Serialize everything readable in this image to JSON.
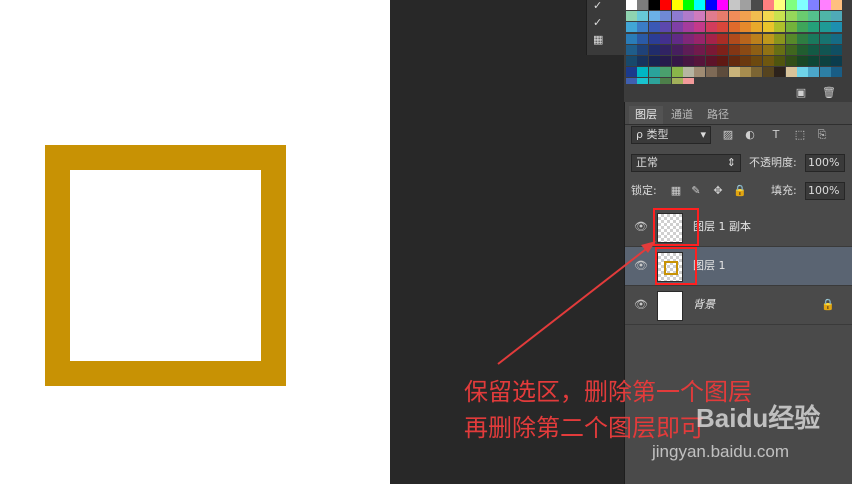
{
  "canvas": {
    "frame_color": "#c89204",
    "background_color": "#ffffff"
  },
  "swatches": {
    "rows": [
      [
        "#ffffff",
        "#7d7d7d",
        "#000000",
        "#ff0000",
        "#ffff00",
        "#00ff00",
        "#00ffff",
        "#0000ff",
        "#ff00ff",
        "#c6c6c6",
        "#a0a0a0",
        "#4b4b4b",
        "#ff8080",
        "#ffff80",
        "#80ff80",
        "#80ffff",
        "#8080ff",
        "#ff80ff",
        "#ffc080"
      ],
      [
        "#8fd3b0",
        "#67c9d8",
        "#6bb0e6",
        "#6f8ad6",
        "#8d7bd1",
        "#b07bcb",
        "#d07bbd",
        "#e07b8d",
        "#e67b6b",
        "#f28c59",
        "#f2a14f",
        "#f2bd4f",
        "#f2d84f",
        "#c9e24f",
        "#96d65a",
        "#6acb6f",
        "#54c08c",
        "#4fb5a7",
        "#4faab8"
      ],
      [
        "#41a6d6",
        "#3b7dc6",
        "#3b59b5",
        "#5c48ad",
        "#7f40a6",
        "#a53c9c",
        "#c4398a",
        "#d23c5c",
        "#d8463b",
        "#df6a2c",
        "#e5892b",
        "#e8a92b",
        "#eac42b",
        "#aec02b",
        "#73b23b",
        "#3ea55a",
        "#24a07a",
        "#1f9a95",
        "#1d8fb0"
      ],
      [
        "#2a7cb7",
        "#2a5aa6",
        "#2b3d95",
        "#43308d",
        "#602b86",
        "#802778",
        "#98246a",
        "#a5234a",
        "#aa2d25",
        "#b04b1c",
        "#b8651c",
        "#bc801c",
        "#bf981c",
        "#8a951c",
        "#57892a",
        "#2e7d42",
        "#1a795d",
        "#17736f",
        "#156b85"
      ],
      [
        "#1f5d8a",
        "#1f4279",
        "#202c6b",
        "#312363",
        "#461f5e",
        "#5e1d56",
        "#711a4c",
        "#7a1935",
        "#7e2119",
        "#833614",
        "#8a4a14",
        "#8e5f14",
        "#917214",
        "#676f14",
        "#40661f",
        "#215d30",
        "#135a45",
        "#115552",
        "#0f4f63"
      ],
      [
        "#18496c",
        "#18335d",
        "#192352",
        "#261b4c",
        "#351748",
        "#471542",
        "#56143b",
        "#5d1329",
        "#5f1913",
        "#64290f",
        "#6a390f",
        "#6d490f",
        "#6f570f",
        "#4f550f",
        "#314e18",
        "#194725",
        "#0e4535",
        "#0d413f",
        "#0b3c4c"
      ],
      [
        "#1b3a8c",
        "#00b7c3",
        "#2aa39b",
        "#4aa06d",
        "#8ab54a",
        "#b6b5a2",
        "#a08c73",
        "#7e6a56",
        "#5d4c3c",
        "#c9b37a",
        "#a78d4f",
        "#7c6533",
        "#56441f",
        "#2d231c",
        "#d8c39a",
        "#6fd3e8",
        "#4ba6c9",
        "#2d7fa5",
        "#195d85"
      ],
      [
        "#3f5fb0",
        "#19c3cf",
        "#2da39b",
        "#4d7f4a",
        "#a3b15a",
        "#f29a9a"
      ]
    ]
  },
  "layers_panel": {
    "tabs": [
      {
        "label": "图层"
      },
      {
        "label": "通道"
      },
      {
        "label": "路径"
      }
    ],
    "filter_label": "ρ 类型",
    "blend_mode": "正常",
    "opacity_label": "不透明度:",
    "opacity_value": "100%",
    "lock_label": "锁定:",
    "fill_label": "填充:",
    "fill_value": "100%",
    "layers": [
      {
        "name": "图层 1 副本",
        "selected": false
      },
      {
        "name": "图层 1",
        "selected": true
      },
      {
        "name": "背景",
        "selected": false
      }
    ]
  },
  "annotation": {
    "line1": "保留选区，删除第一个图层",
    "line2": "再删除第二个图层即可",
    "color": "#e23b3b"
  },
  "watermark": {
    "logo_text": "Baidu经验",
    "url_text": "jingyan.baidu.com"
  },
  "icons": [
    "check-icon",
    "eye-icon",
    "lock-icon",
    "trash-icon",
    "new-layer-icon",
    "arrow-icon"
  ]
}
